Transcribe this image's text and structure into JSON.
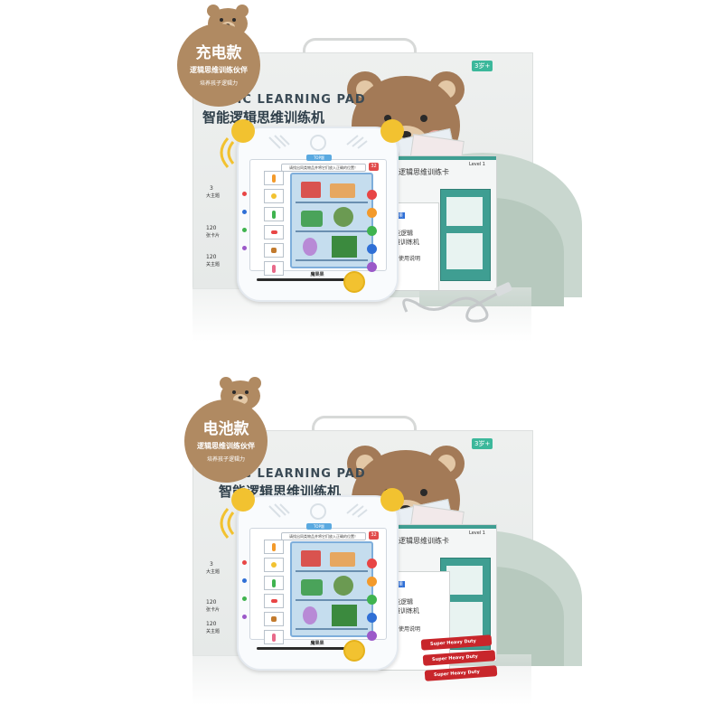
{
  "variants": [
    {
      "badge_title": "充电款",
      "badge_line1": "逻辑思维训练伙伴",
      "badge_line2": "培养孩子逻辑力"
    },
    {
      "badge_title": "电池款",
      "badge_line1": "逻辑思维训练伙伴",
      "badge_line2": "培养孩子逻辑力"
    }
  ],
  "box": {
    "title_en": "LOGIC LEARNING PAD",
    "title_cn": "智能逻辑思维训练机",
    "age_badge": "3岁+",
    "side_labels": [
      "3",
      "大主题",
      "120",
      "张卡片",
      "120",
      "关主题"
    ]
  },
  "pad": {
    "top_tab": "TOP题",
    "header_text": "请找出同类物品并将它们放入正确的位置！",
    "number": "32",
    "brand": "魔果果"
  },
  "card_book": {
    "title": "逻辑思维训练卡",
    "level": "Level 1"
  },
  "manual": {
    "brand": "魔果果",
    "line1": "智能逻辑",
    "line2": "思维训练机",
    "line3": "产品使用说明"
  },
  "batteries": {
    "label": "Super Heavy Duty"
  },
  "colors": {
    "badge_brown": "#b08a62",
    "bear_brown": "#a37a57",
    "pad_yellow": "#f2c230",
    "card_teal": "#3f9e92",
    "dot_red": "#e84545",
    "dot_orange": "#f39a2b",
    "dot_yellow": "#f2c230",
    "dot_green": "#3fb34f",
    "dot_blue": "#2f6fd6",
    "dot_purple": "#9b59c9",
    "battery_red": "#c8262b"
  }
}
